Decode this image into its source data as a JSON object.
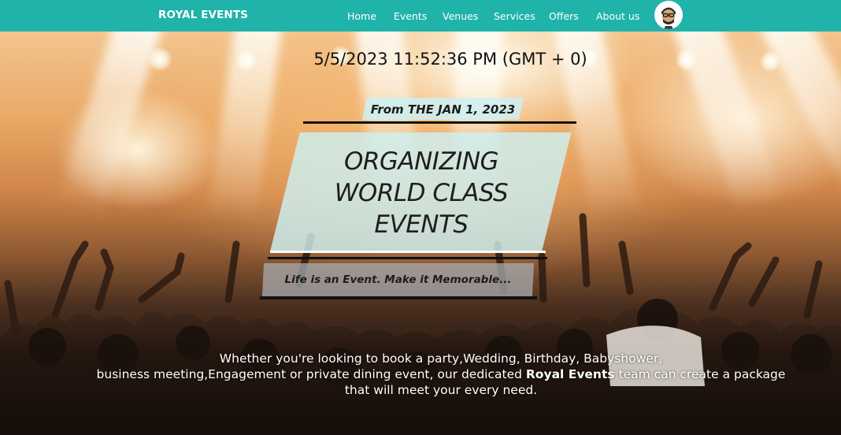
{
  "brand": {
    "name": "ROYAL EVENTS"
  },
  "nav": {
    "items": [
      {
        "label": "Home"
      },
      {
        "label": "Events"
      },
      {
        "label": "Venues"
      },
      {
        "label": "Services"
      },
      {
        "label": "Offers"
      },
      {
        "label": "About us"
      }
    ],
    "avatar_icon": "user-avatar-icon"
  },
  "hero": {
    "datetime": "5/5/2023 11:52:36 PM (GMT + 0)",
    "since": "From THE JAN 1, 2023",
    "headline": [
      "ORGANIZING",
      "WORLD CLASS",
      "EVENTS"
    ],
    "tagline": "Life is an Event. Make it Memorable...",
    "description": {
      "line1": "Whether you're looking to book a party,Wedding, Birthday, Babyshower,",
      "line2_before": "business meeting,Engagement or private dining event, our dedicated ",
      "line2_brand": "Royal Events",
      "line2_after": " team can create a package",
      "line3": "that will meet your every need."
    }
  },
  "colors": {
    "nav_bg": "#1fb3aa",
    "panel_bg": "#cdf0f2",
    "tagline_bg": "#aaafb4",
    "text_dark": "#1e1e1e"
  }
}
